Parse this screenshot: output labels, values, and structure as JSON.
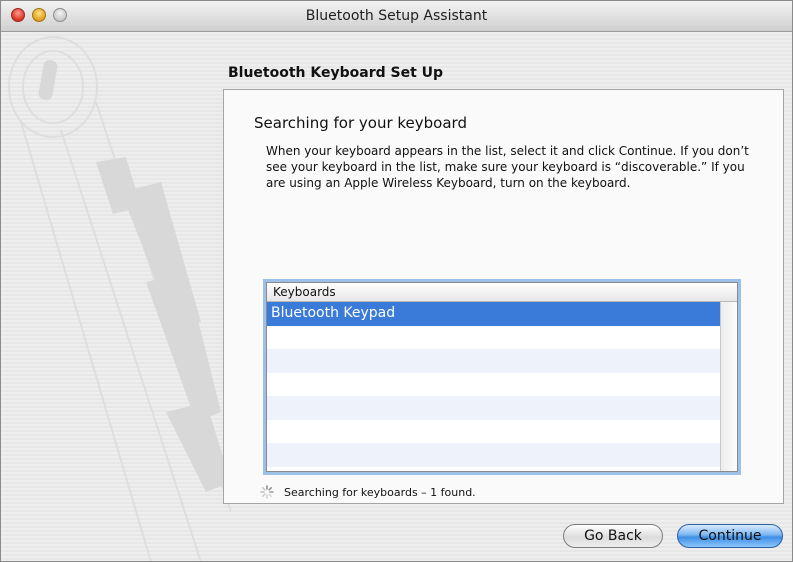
{
  "window": {
    "title": "Bluetooth Setup Assistant"
  },
  "page": {
    "heading": "Bluetooth Keyboard Set Up"
  },
  "panel": {
    "title": "Searching for your keyboard",
    "description": "When your keyboard appears in the list, select it and click Continue. If you don’t see your keyboard in the list, make sure your keyboard is “discoverable.”  If you are using an Apple Wireless Keyboard, turn on the keyboard."
  },
  "keyboard_list": {
    "header": "Keyboards",
    "items": [
      "Bluetooth  Keypad"
    ],
    "selected_index": 0
  },
  "status": {
    "text": "Searching for keyboards – 1 found."
  },
  "buttons": {
    "go_back": "Go Back",
    "continue": "Continue"
  },
  "colors": {
    "selection": "#3a7ad8",
    "focus_ring": "#9cc0e8",
    "default_button": "#3e8ee6"
  }
}
